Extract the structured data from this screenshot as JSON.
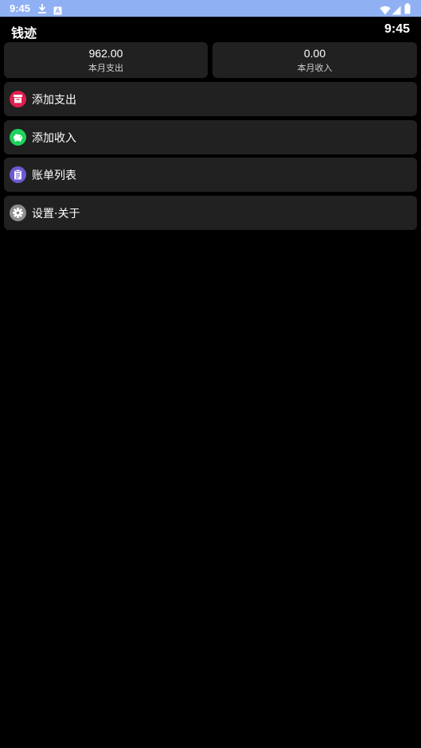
{
  "status_bar": {
    "time": "9:45",
    "left_icons": [
      "download-icon",
      "a11y-a-icon"
    ],
    "right_icons": [
      "wifi-icon",
      "signal-icon",
      "battery-icon"
    ],
    "background_color": "#8fb0f3"
  },
  "header": {
    "title": "钱迹",
    "clock": "9:45"
  },
  "summary": {
    "expense": {
      "value": "962.00",
      "label": "本月支出"
    },
    "income": {
      "value": "0.00",
      "label": "本月收入"
    }
  },
  "menu": {
    "items": [
      {
        "label": "添加支出",
        "icon": "expense-box-icon",
        "icon_color": "#e0204f"
      },
      {
        "label": "添加收入",
        "icon": "income-piggy-icon",
        "icon_color": "#1ed25c"
      },
      {
        "label": "账单列表",
        "icon": "clipboard-icon",
        "icon_color": "#6a5ad3"
      },
      {
        "label": "设置·关于",
        "icon": "gear-icon",
        "icon_color": "#8e8e8e"
      }
    ]
  }
}
